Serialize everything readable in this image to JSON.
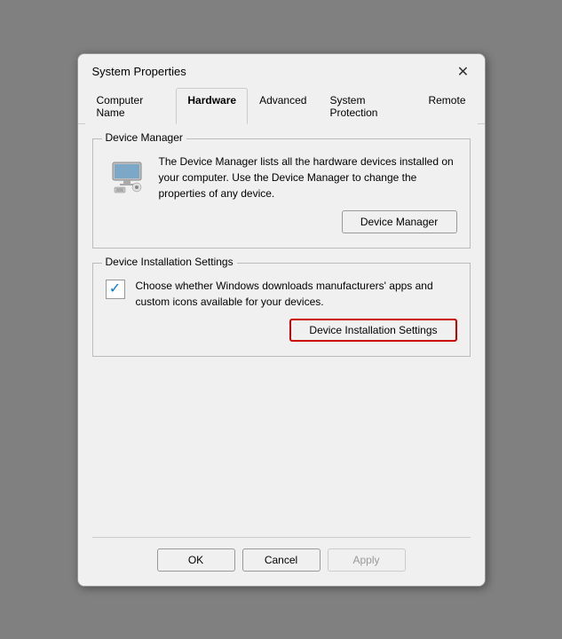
{
  "window": {
    "title": "System Properties",
    "close_label": "✕"
  },
  "tabs": [
    {
      "id": "computer-name",
      "label": "Computer Name",
      "active": false
    },
    {
      "id": "hardware",
      "label": "Hardware",
      "active": true
    },
    {
      "id": "advanced",
      "label": "Advanced",
      "active": false
    },
    {
      "id": "system-protection",
      "label": "System Protection",
      "active": false
    },
    {
      "id": "remote",
      "label": "Remote",
      "active": false
    }
  ],
  "device_manager_section": {
    "label": "Device Manager",
    "description": "The Device Manager lists all the hardware devices installed on your computer. Use the Device Manager to change the properties of any device.",
    "button_label": "Device Manager"
  },
  "device_installation_section": {
    "label": "Device Installation Settings",
    "description": "Choose whether Windows downloads manufacturers' apps and custom icons available for your devices.",
    "button_label": "Device Installation Settings",
    "checkbox_checked": true
  },
  "footer": {
    "ok_label": "OK",
    "cancel_label": "Cancel",
    "apply_label": "Apply"
  },
  "colors": {
    "highlight_border": "#cc0000",
    "check_color": "#0078d4"
  }
}
